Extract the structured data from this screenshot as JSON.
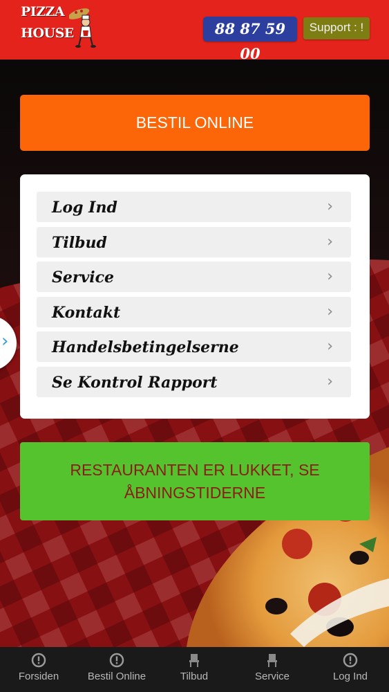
{
  "header": {
    "logo_line1": "PIZZA",
    "logo_line2": "HOUSE",
    "phone": "88 87 59 00",
    "support_label": "Support : !"
  },
  "main": {
    "order_button": "BESTIL ONLINE",
    "menu_items": [
      {
        "label": "Log Ind"
      },
      {
        "label": "Tilbud"
      },
      {
        "label": "Service"
      },
      {
        "label": "Kontakt"
      },
      {
        "label": "Handelsbetingelserne"
      },
      {
        "label": "Se Kontrol Rapport"
      }
    ],
    "chevron": "›",
    "closed_notice": "RESTAURANTEN ER LUKKET, SE ÅBNINGSTIDERNE"
  },
  "side_tab": {
    "glyph": "›"
  },
  "bottom_nav": [
    {
      "label": "Forsiden",
      "icon": "info-circle-icon"
    },
    {
      "label": "Bestil Online",
      "icon": "info-circle-icon"
    },
    {
      "label": "Tilbud",
      "icon": "chair-icon"
    },
    {
      "label": "Service",
      "icon": "chair-icon"
    },
    {
      "label": "Log Ind",
      "icon": "info-circle-icon"
    }
  ],
  "colors": {
    "header_red": "#e3231c",
    "order_orange": "#fc6508",
    "phone_blue": "#2c3e9e",
    "support_olive": "#7d7d14",
    "closed_green": "#55c32d",
    "closed_text": "#8b1d18",
    "nav_bg": "#1a1a1a"
  }
}
